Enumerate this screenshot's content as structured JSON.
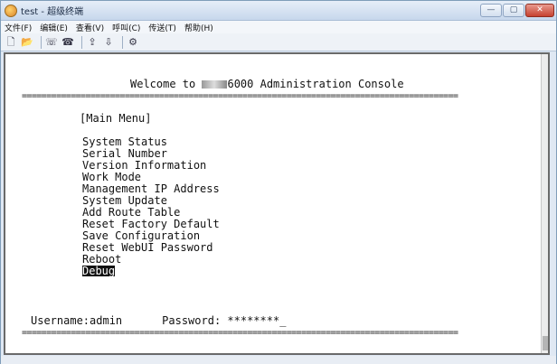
{
  "window": {
    "title": "test - 超级终端"
  },
  "menu": [
    "文件(F)",
    "编辑(E)",
    "查看(V)",
    "呼叫(C)",
    "传送(T)",
    "帮助(H)"
  ],
  "toolbar": [
    "new-icon",
    "open-icon",
    "disconnect-icon",
    "dial-icon",
    "send-icon",
    "receive-icon",
    "properties-icon"
  ],
  "terminal": {
    "welcome_prefix": "Welcome to ",
    "welcome_suffix": "6000 Administration Console",
    "rule": "=========================================================================================",
    "main_menu": "[Main Menu]",
    "items": [
      "System Status",
      "Serial Number",
      "Version Information",
      "Work Mode",
      "Management IP Address",
      "System Update",
      "Add Route Table",
      "Reset Factory Default",
      "Save Configuration",
      "Reset WebUI Password",
      "Reboot",
      "Debug"
    ],
    "selected_item": "Debug",
    "username_label": "Username:admin",
    "password_label": "Password: ",
    "password_value": "********_"
  }
}
